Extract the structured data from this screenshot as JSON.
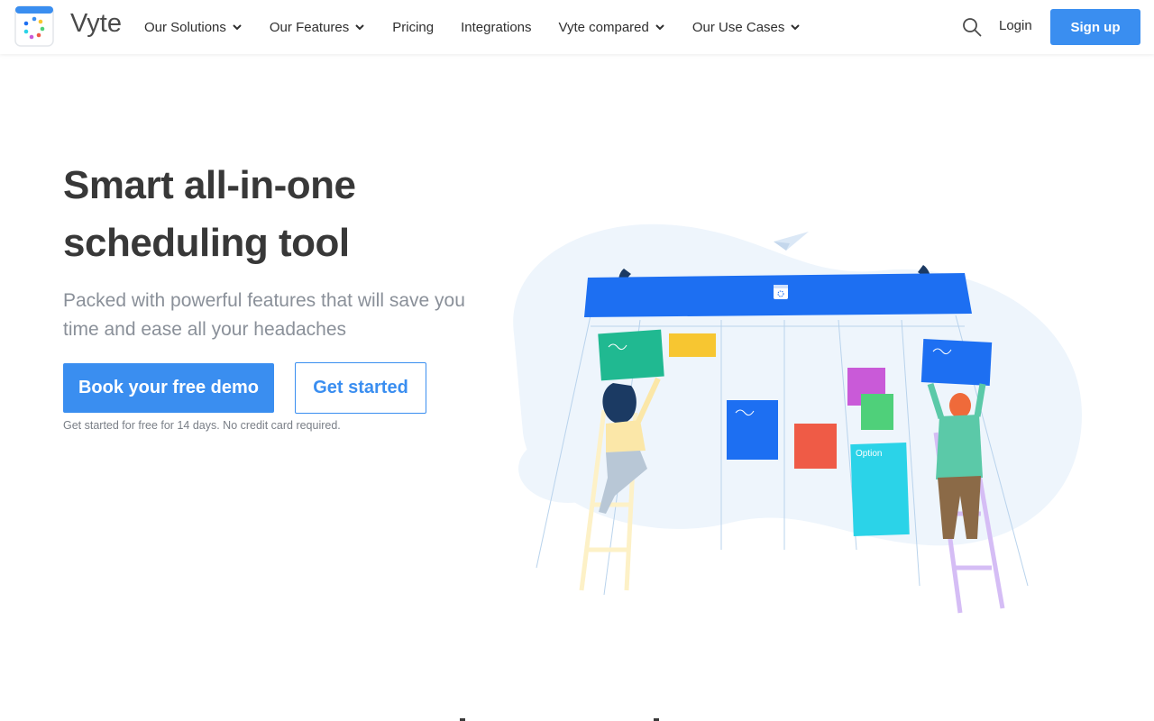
{
  "brand": {
    "name": "Vyte",
    "accent": "#3a8ef0"
  },
  "nav": {
    "items": [
      {
        "label": "Our Solutions",
        "dropdown": true
      },
      {
        "label": "Our Features",
        "dropdown": true
      },
      {
        "label": "Pricing",
        "dropdown": false
      },
      {
        "label": "Integrations",
        "dropdown": false
      },
      {
        "label": "Vyte compared",
        "dropdown": true
      },
      {
        "label": "Our Use Cases",
        "dropdown": true
      }
    ],
    "login_label": "Login",
    "signup_label": "Sign up"
  },
  "hero": {
    "title_line1": "Smart all-in-one",
    "title_line2": "scheduling tool",
    "subtitle": "Packed with powerful features that will save you time and ease all your headaches",
    "demo_label": "Book your free demo",
    "start_label": "Get started",
    "note": "Get started for free for 14 days. No credit card required."
  },
  "illustration": {
    "card_label": "Option"
  }
}
